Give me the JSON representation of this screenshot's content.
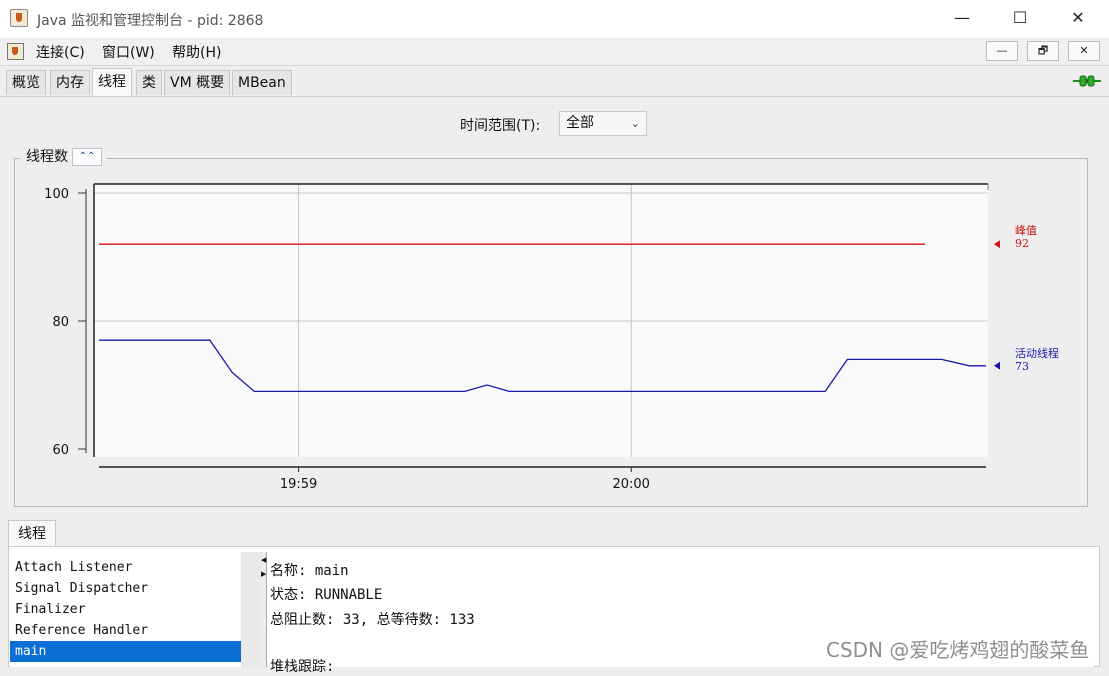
{
  "window": {
    "title": "Java 监视和管理控制台 - pid: 2868",
    "minimize_glyph": "—",
    "maximize_glyph": "☐",
    "close_glyph": "✕"
  },
  "menubar": {
    "items": [
      "连接(C)",
      "窗口(W)",
      "帮助(H)"
    ],
    "mdi_buttons": [
      "—",
      "🗗",
      "✕"
    ]
  },
  "tabs": [
    "概览",
    "内存",
    "线程",
    "类",
    "VM 概要",
    "MBean"
  ],
  "active_tab": "线程",
  "connection_icon": "plug-connected-icon",
  "time_range": {
    "label": "时间范围(T):",
    "selected": "全部"
  },
  "chart_panel": {
    "title": "线程数",
    "collapse_glyph": "⌃⌃"
  },
  "chart_data": {
    "type": "line",
    "x_ticks": [
      "19:59",
      "20:00"
    ],
    "ylim": [
      60,
      100
    ],
    "y_ticks": [
      60,
      80,
      100
    ],
    "grid": true,
    "legend": "right",
    "series": [
      {
        "name": "峰值",
        "color": "#dd1111",
        "current": "92",
        "points": [
          [
            "19:58:24",
            92
          ],
          [
            "20:00:53",
            92
          ]
        ]
      },
      {
        "name": "活动线程",
        "color": "#1a1aaa",
        "current": "73",
        "points": [
          [
            "19:58:24",
            77
          ],
          [
            "19:58:44",
            77
          ],
          [
            "19:58:48",
            72
          ],
          [
            "19:58:52",
            69
          ],
          [
            "19:59:30",
            69
          ],
          [
            "19:59:34",
            70
          ],
          [
            "19:59:38",
            69
          ],
          [
            "20:00:35",
            69
          ],
          [
            "20:00:39",
            74
          ],
          [
            "20:00:56",
            74
          ],
          [
            "20:01:01",
            73
          ],
          [
            "20:01:04",
            73
          ]
        ]
      }
    ]
  },
  "lower": {
    "tab": "线程",
    "threads": [
      "Attach Listener",
      "Signal Dispatcher",
      "Finalizer",
      "Reference Handler",
      "main"
    ],
    "selected_thread": "main",
    "details": {
      "name_line": "名称: main",
      "state_line": "状态: RUNNABLE",
      "counts_line": "总阻止数: 33, 总等待数: 133",
      "stack_line": "堆栈跟踪:"
    }
  },
  "watermark": "CSDN @爱吃烤鸡翅的酸菜鱼"
}
